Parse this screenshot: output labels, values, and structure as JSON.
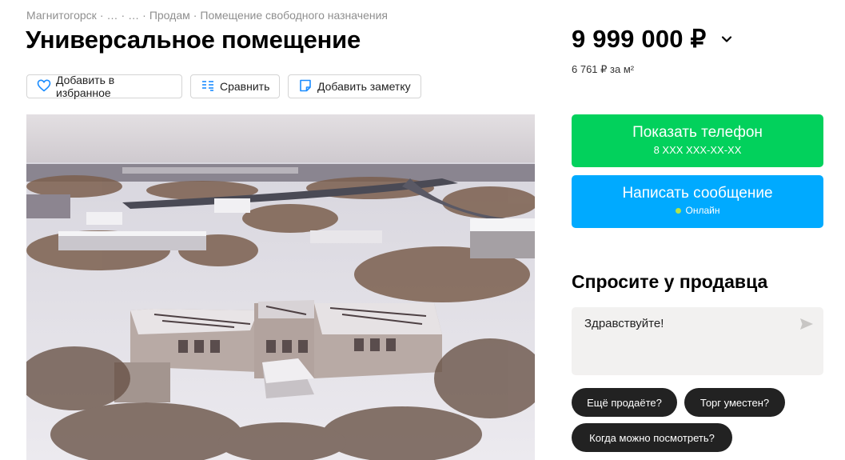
{
  "breadcrumb": {
    "items": [
      "Магнитогорск",
      "…",
      "…",
      "Продам",
      "Помещение свободного назначения"
    ],
    "separator": "·"
  },
  "title": "Универсальное помещение",
  "actions": {
    "favorite": "Добавить в избранное",
    "compare": "Сравнить",
    "note": "Добавить заметку"
  },
  "price": {
    "value": "9 999 000 ₽",
    "per_m2": "6 761 ₽ за м²"
  },
  "contact": {
    "show_phone": "Показать телефон",
    "phone_mask": "8 XXX XXX-XX-XX",
    "write_message": "Написать сообщение",
    "online": "Онлайн",
    "colors": {
      "phone_button": "#02d15c",
      "message_button": "#00aaff",
      "online_dot": "#b2e349"
    }
  },
  "ask_seller": {
    "title": "Спросите у продавца",
    "message_value": "Здравствуйте!",
    "quick_questions": [
      "Ещё продаёте?",
      "Торг уместен?",
      "Когда можно посмотреть?"
    ]
  },
  "icons": [
    "heart-icon",
    "compare-icon",
    "note-icon",
    "chevron-down-icon",
    "send-icon"
  ]
}
